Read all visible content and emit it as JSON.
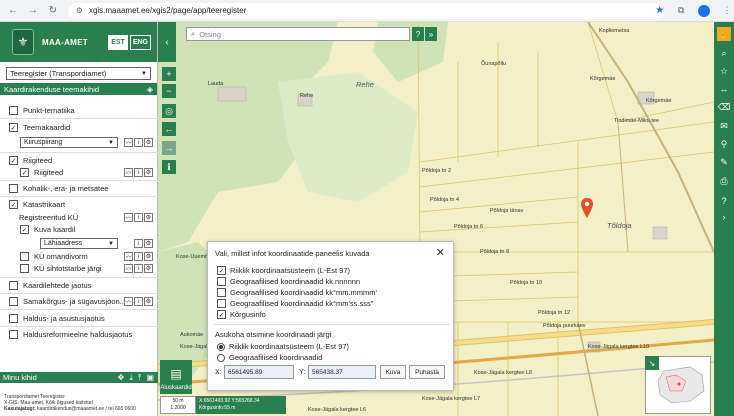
{
  "browser": {
    "url": "xgis.maaamet.ee/xgis2/page/app/teeregister"
  },
  "header": {
    "logo_text": "MAA-AMET",
    "lang_est": "EST",
    "lang_eng": "ENG"
  },
  "sidebar": {
    "layer_select": "Teeregister (Transpordiamet)",
    "section_title": "Kaardirakenduse teemakihid",
    "items": {
      "punkt": "Punkt-tematiika",
      "teemakaardid": "Teemakaardid",
      "kiiruspiirang": "Kiiruspiirang",
      "riigiteed": "Riigiteed",
      "riigiteed_sub": "Riigiteed",
      "kohalik": "Kohalik-, era- ja metsatee",
      "katastri": "Katastrikaart",
      "registreeritud": "Registreeritud KÜ",
      "kuva_kaardil": "Kuva kaardil",
      "lahiaadress": "Lähiaadress",
      "omandivorm": "KÜ omandivorm",
      "sihtotstarbe": "KÜ sihtotstarbe järgi",
      "kaardilehtede": "Kaardilehtede jaotus",
      "samakorgus": "Samakõrgus- ja sügavusjoon...",
      "haldus": "Haldus- ja asustusjaotus",
      "haldusreform": "Haldusreformieelne haldusjaotus"
    },
    "menu_title": "Minu kihid",
    "footer": {
      "line1": "Transpordiamet Teeregister",
      "line2": "X-GIS: Maa-amet. Kõik õigused kaitstud",
      "line3_label": "Kasutajatugi:",
      "line3_value": "kaardirakendus@maaamet.ee / tel 665 0600"
    }
  },
  "search": {
    "placeholder": "Otsing"
  },
  "map": {
    "labels": {
      "kopliemetsa": "Kopliemetsa",
      "ounapollu": "Õunapõllu",
      "lauda": "Lauda",
      "rehe_small": "Rehe",
      "rehe_big": "Rehe",
      "korgemae1": "Kõrgemäe",
      "korgemae2": "Kõrgemäe",
      "tindimae": "Tindimäe-Miku tee",
      "poldoja2": "Põldoja tn 2",
      "poldoja4": "Põldoja tn 4",
      "poldoja_tanav": "Põldoja tänav",
      "poldoja6": "Põldoja tn 6",
      "poldoja8": "Põldoja tn 8",
      "poldoja10": "Põldoja tn 10",
      "poldoja12": "Põldoja tn 12",
      "poldoja_puurkaev": "Põldoja puurkaev",
      "toldoja": "Tõldoja",
      "koseuuemoisa": "Kose-Uuemõisa tee",
      "l10": "Kose-Jägala kergtee L10",
      "l8": "Kose-Jägala kergtee L8",
      "l7": "Kose-Jägala kergtee L7",
      "l6": "Kose-Jägala kergtee L6",
      "aukomae": "Aukomäe",
      "kose_jag": "Kose-Jägala kergt"
    }
  },
  "dialog": {
    "title": "Vali, millist infot koordinaatide paneelis kuvada",
    "options": [
      {
        "label": "Riiklik koordinaatsüsteem (L-Est 97)",
        "checked": true
      },
      {
        "label": "Geograafilised koordinaadid kk.nnnnnn",
        "checked": false
      },
      {
        "label": "Geograafilised koordinaadid kk°mm.mmmm'",
        "checked": false
      },
      {
        "label": "Geograafilised koordinaadid kk°mm'ss.sss\"",
        "checked": false
      },
      {
        "label": "Kõrgusinfo",
        "checked": true
      }
    ],
    "subtitle": "Asukoha otsimine koordinaadi järgi",
    "radios": [
      {
        "label": "Riiklik koordinaatsüsteem (L-Est 97)",
        "selected": true
      },
      {
        "label": "Geograafilised koordinaadid",
        "selected": false
      }
    ],
    "x_label": "X:",
    "x_value": "6561495.89",
    "y_label": "Y:",
    "y_value": "565438.37",
    "show_button": "Kuva",
    "clear_button": "Puhasta"
  },
  "bottom": {
    "basemap_label": "Aluskaardid",
    "scale_top": "50 m",
    "scale_bottom": "1:2000",
    "coords_line1": "X:6561493.92 Y:565268.34",
    "coords_line2": "Kõrgusinfo:55 m"
  },
  "colors": {
    "brand_green": "#2a7f4f",
    "highlight_orange": "#f5a623",
    "map_yellow": "#f3efc7",
    "forest_green": "#cfe3b6",
    "pin_red": "#e2512b"
  }
}
